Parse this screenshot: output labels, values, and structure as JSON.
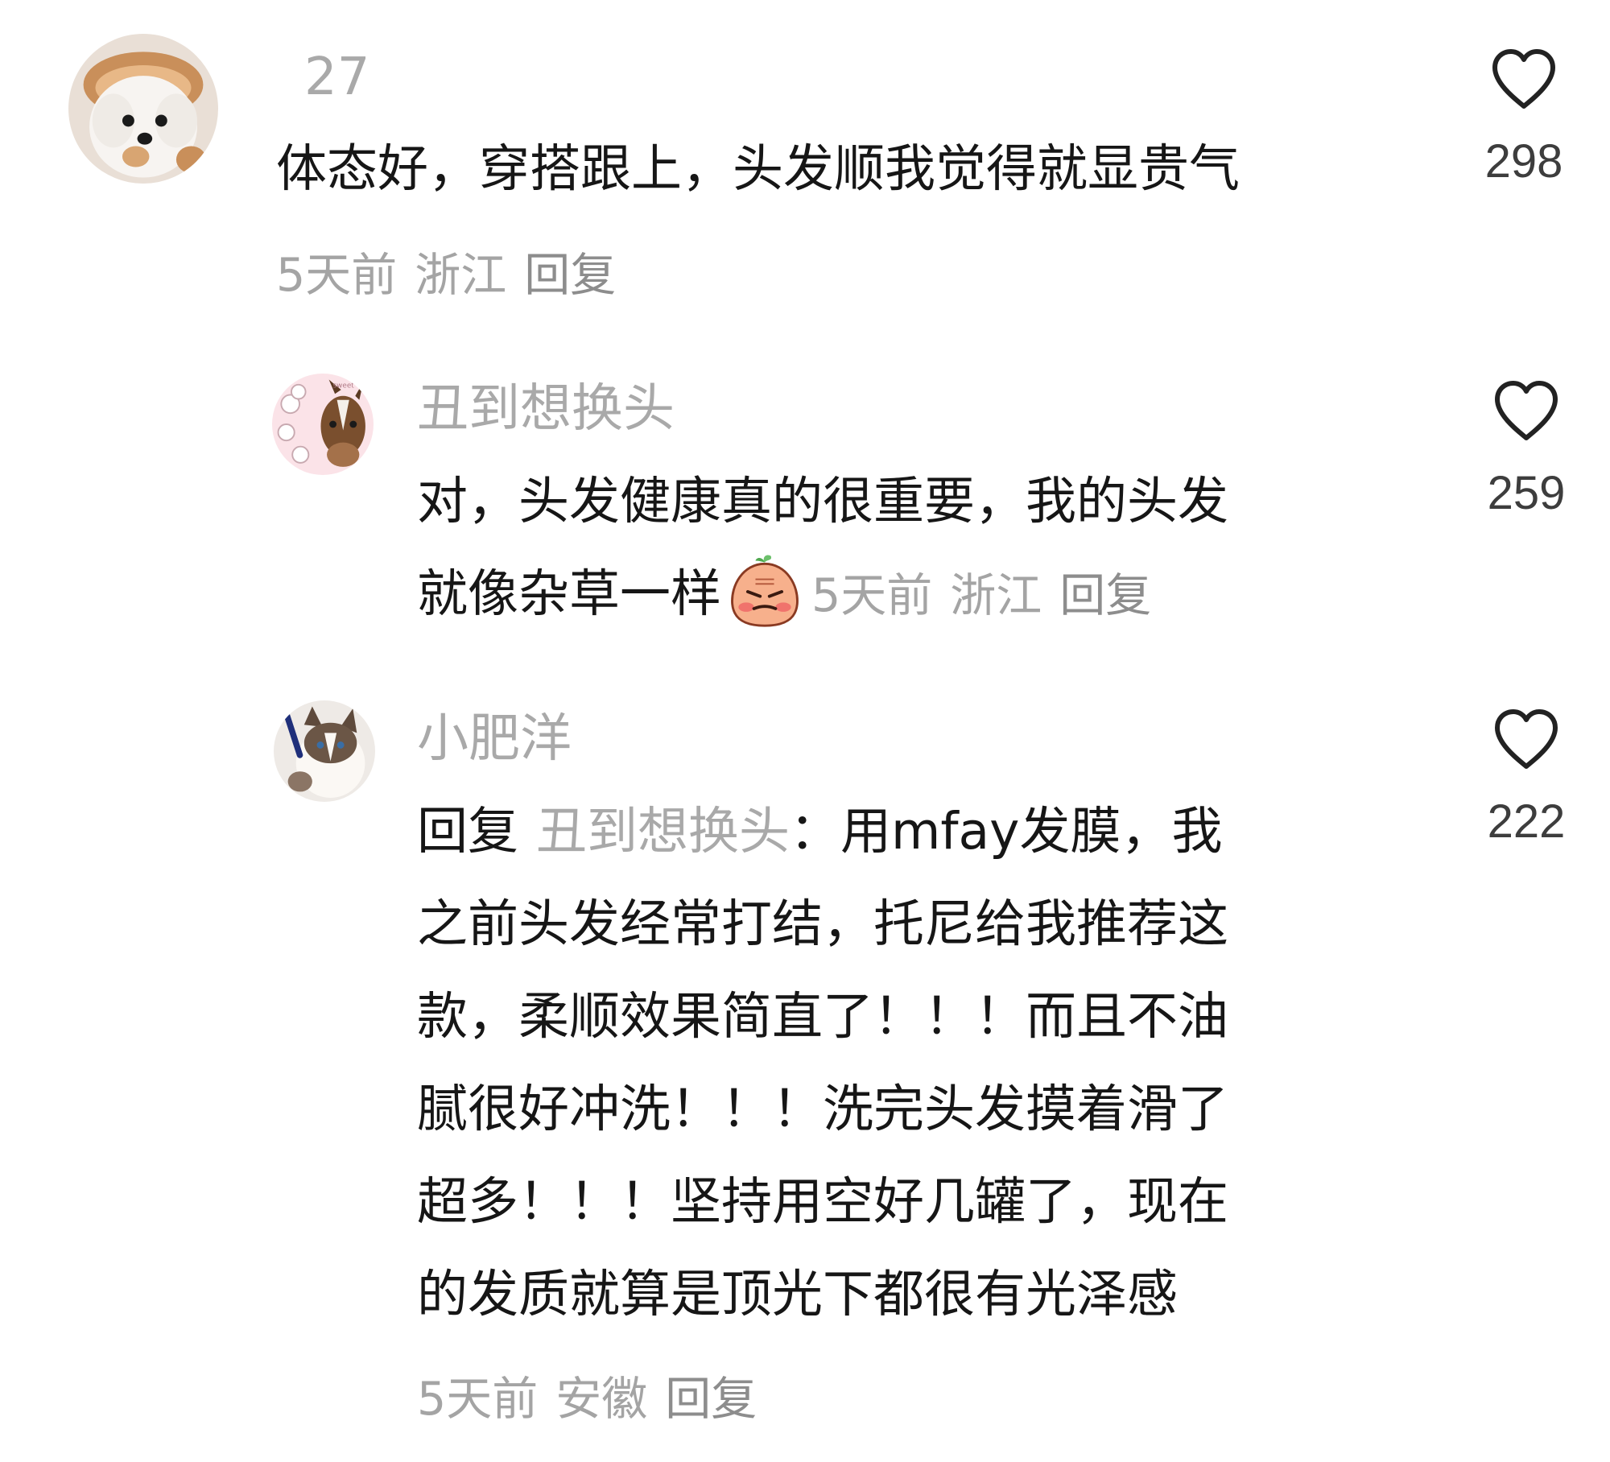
{
  "comments": [
    {
      "username": "27",
      "text": "体态好，穿搭跟上，头发顺我觉得就显贵气",
      "time": "5天前",
      "location": "浙江",
      "reply_label": "回复",
      "likes": "298",
      "avatar_icon": "white-dog-avatar"
    },
    {
      "username": "丑到想换头",
      "text_line1": "对，头发健康真的很重要，我的头发",
      "text_line2": "就像杂草一样",
      "emoji_icon": "embarrassed-blush-emoji",
      "time": "5天前",
      "location": "浙江",
      "reply_label": "回复",
      "likes": "259",
      "avatar_icon": "cartoon-horse-avatar"
    },
    {
      "username": "小肥洋",
      "reply_prefix": "回复",
      "reply_target": "丑到想换头",
      "lines": [
        "：用mfay发膜，我",
        "之前头发经常打结，托尼给我推荐这",
        "款，柔顺效果简直了！！！而且不油",
        "腻很好冲洗！！！洗完头发摸着滑了",
        "超多！！！坚持用空好几罐了，现在",
        "的发质就算是顶光下都很有光泽感"
      ],
      "time": "5天前",
      "location": "安徽",
      "reply_label": "回复",
      "likes": "222",
      "avatar_icon": "ragdoll-cat-avatar"
    }
  ],
  "colors": {
    "text": "#161616",
    "muted": "#a9a9a9",
    "count": "#3d3d3d",
    "heart_stroke": "#222222"
  }
}
